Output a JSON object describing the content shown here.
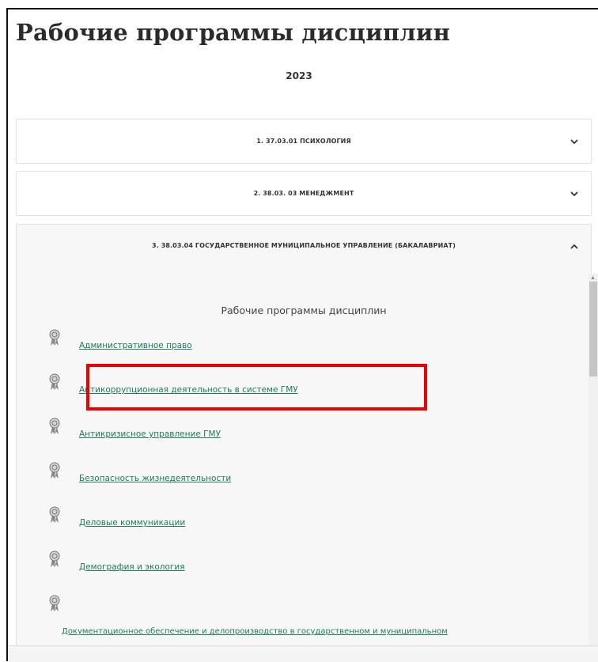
{
  "header": {
    "title": "Рабочие программы дисциплин",
    "year": "2023"
  },
  "panels": [
    {
      "label": "1. 37.03.01 ПСИХОЛОГИЯ",
      "state": "collapsed"
    },
    {
      "label": "2. 38.03. 03 МЕНЕДЖМЕНТ",
      "state": "collapsed"
    },
    {
      "label": "3. 38.03.04 ГОСУДАРСТВЕННОЕ МУНИЦИПАЛЬНОЕ УПРАВЛЕНИЕ (БАКАЛАВРИАТ)",
      "state": "expanded"
    }
  ],
  "expanded": {
    "heading": "Рабочие программы дисциплин",
    "items": [
      "Административное право",
      "Антикоррупционная деятельность в системе ГМУ",
      "Антикризисное управление ГМУ",
      "Безопасность жизнедеятельности",
      "Деловые коммуникации",
      "Демография и экология",
      "Документационное обеспечение и делопроизводство в государственном и муниципальном"
    ]
  },
  "icons": {
    "item": "award-ribbon-icon",
    "collapsed": "chevron-down-icon",
    "expanded": "chevron-up-icon"
  },
  "colors": {
    "link": "#1f7a5c",
    "highlight": "#ee0000",
    "panel_border": "#e2e2e2",
    "expanded_bg": "#f7f7f7"
  }
}
